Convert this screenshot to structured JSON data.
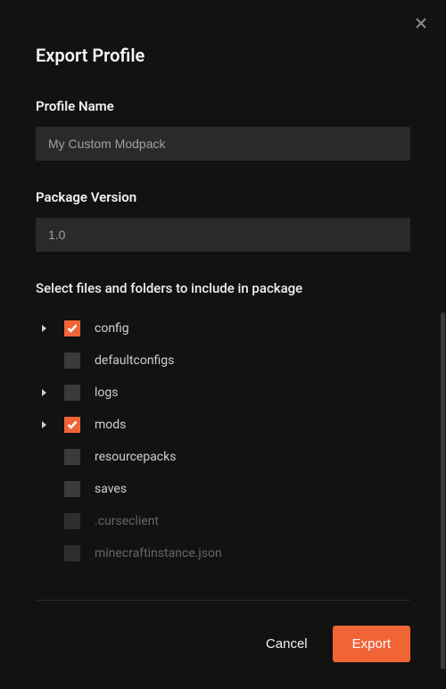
{
  "modal": {
    "title": "Export Profile",
    "profileName": {
      "label": "Profile Name",
      "value": "My Custom Modpack"
    },
    "packageVersion": {
      "label": "Package Version",
      "value": "1.0"
    },
    "filesSection": {
      "label": "Select files and folders to include in package"
    },
    "items": [
      {
        "label": "config",
        "checked": true,
        "expandable": true,
        "dim": false
      },
      {
        "label": "defaultconfigs",
        "checked": false,
        "expandable": false,
        "dim": false
      },
      {
        "label": "logs",
        "checked": false,
        "expandable": true,
        "dim": false
      },
      {
        "label": "mods",
        "checked": true,
        "expandable": true,
        "dim": false
      },
      {
        "label": "resourcepacks",
        "checked": false,
        "expandable": false,
        "dim": false
      },
      {
        "label": "saves",
        "checked": false,
        "expandable": false,
        "dim": false
      },
      {
        "label": ".curseclient",
        "checked": false,
        "expandable": false,
        "dim": true
      },
      {
        "label": "minecraftinstance.json",
        "checked": false,
        "expandable": false,
        "dim": true
      }
    ],
    "footer": {
      "cancel": "Cancel",
      "export": "Export"
    }
  }
}
